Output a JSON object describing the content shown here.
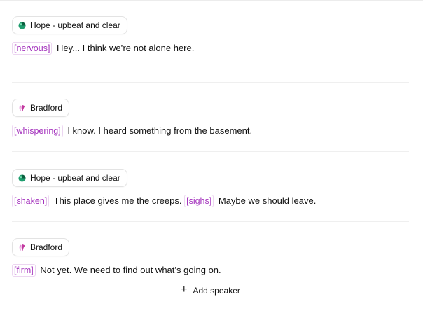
{
  "blocks": [
    {
      "speaker": "Hope - upbeat and clear",
      "avatar": "hope-avatar-icon",
      "segments": [
        {
          "type": "tag",
          "text": "[nervous]"
        },
        {
          "type": "text",
          "text": "Hey... I think we’re not alone here."
        }
      ]
    },
    {
      "speaker": "Bradford",
      "avatar": "bradford-avatar-icon",
      "segments": [
        {
          "type": "tag",
          "text": "[whispering]"
        },
        {
          "type": "text",
          "text": "I know. I heard something from the basement."
        }
      ]
    },
    {
      "speaker": "Hope - upbeat and clear",
      "avatar": "hope-avatar-icon",
      "segments": [
        {
          "type": "tag",
          "text": "[shaken]"
        },
        {
          "type": "text",
          "text": "This place gives me the creeps."
        },
        {
          "type": "tag",
          "text": "[sighs]"
        },
        {
          "type": "text",
          "text": "Maybe we should leave."
        }
      ]
    },
    {
      "speaker": "Bradford",
      "avatar": "bradford-avatar-icon",
      "segments": [
        {
          "type": "tag",
          "text": "[firm]"
        },
        {
          "type": "text",
          "text": "Not yet. We need to find out what’s going on."
        }
      ]
    }
  ],
  "add_speaker": {
    "icon": "plus-icon",
    "label": "Add speaker"
  },
  "colors": {
    "tag_text": "#a433bd",
    "tag_border": "#ecd6f1",
    "hope_avatar": "#1f9d6e",
    "bradford_avatar": "#d14fc4"
  }
}
